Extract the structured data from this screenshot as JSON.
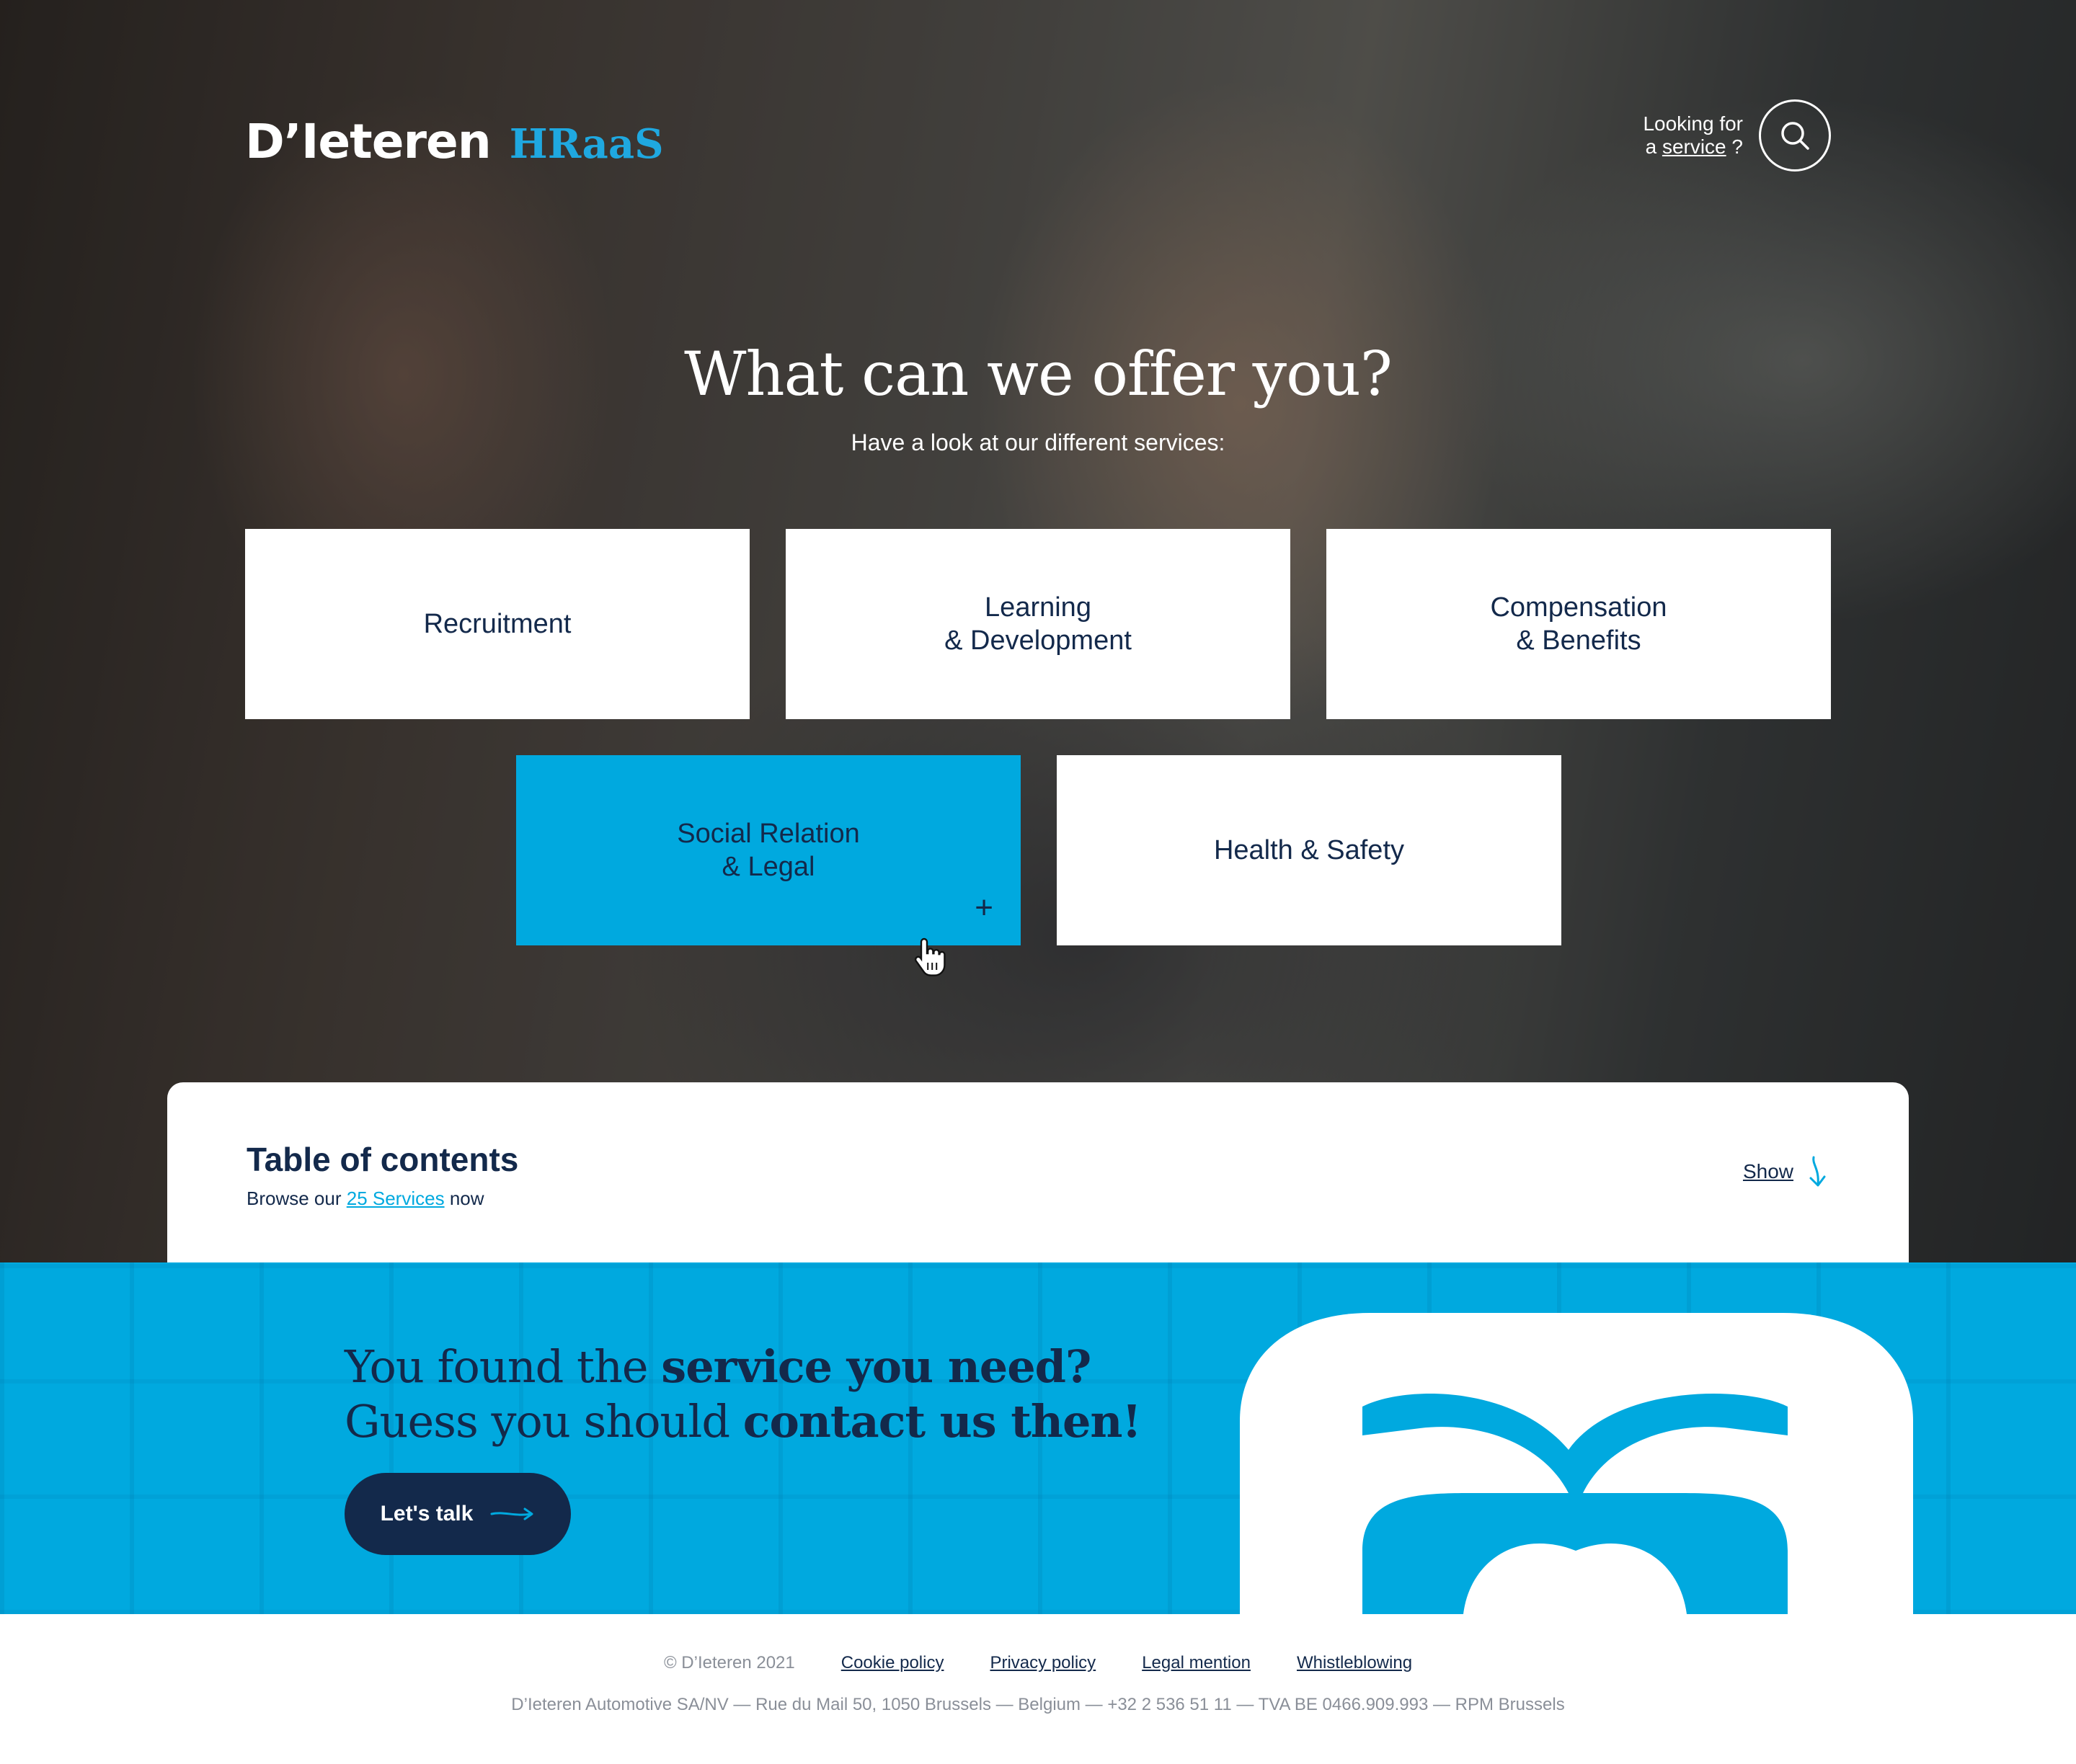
{
  "header": {
    "logo_main": "D’Ieteren",
    "logo_sub": "HRaaS",
    "search_line1": "Looking for",
    "search_line2_prefix": "a",
    "search_line2_link": "service",
    "search_line2_suffix": "?"
  },
  "hero": {
    "title": "What can we offer you?",
    "subtitle": "Have a look at our different services:"
  },
  "services": [
    {
      "label": "Recruitment"
    },
    {
      "label": "Learning\n& Development"
    },
    {
      "label": "Compensation\n& Benefits"
    },
    {
      "label": "Social Relation\n& Legal",
      "plus": "+"
    },
    {
      "label": "Health & Safety"
    }
  ],
  "toc": {
    "title": "Table of contents",
    "browse_prefix": "Browse our",
    "browse_link": "25 Services",
    "browse_suffix": "now",
    "show_label": "Show"
  },
  "cta": {
    "line1_light": "You found the ",
    "line1_bold": "service you need?",
    "line2_light": "Guess you should ",
    "line2_bold": "contact us then!",
    "button_label": "Let's talk"
  },
  "footer": {
    "copyright": "© D’Ieteren 2021",
    "links": [
      "Cookie policy",
      "Privacy policy",
      "Legal mention",
      "Whistleblowing"
    ],
    "address": "D’Ieteren Automotive SA/NV — Rue du Mail 50, 1050 Brussels — Belgium — +32 2 536 51 11 — TVA BE 0466.909.993 — RPM Brussels"
  },
  "colors": {
    "accent": "#00a9df",
    "navy": "#13294b"
  }
}
